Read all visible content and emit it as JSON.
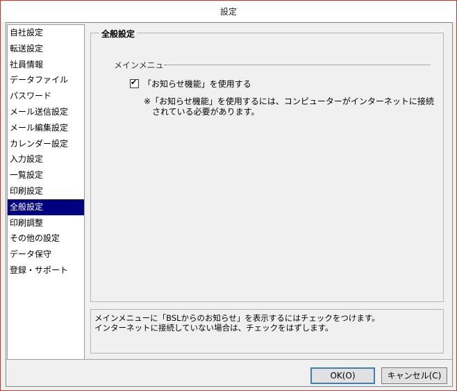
{
  "window": {
    "title": "設定"
  },
  "sidebar": {
    "items": [
      {
        "label": "自社設定"
      },
      {
        "label": "転送設定"
      },
      {
        "label": "社員情報"
      },
      {
        "label": "データファイル"
      },
      {
        "label": "パスワード"
      },
      {
        "label": "メール送信設定"
      },
      {
        "label": "メール編集設定"
      },
      {
        "label": "カレンダー設定"
      },
      {
        "label": "入力設定"
      },
      {
        "label": "一覧設定"
      },
      {
        "label": "印刷設定"
      },
      {
        "label": "全般設定",
        "selected": true
      },
      {
        "label": "印刷調整"
      },
      {
        "label": "その他の設定"
      },
      {
        "label": "データ保守"
      },
      {
        "label": "登録・サポート"
      }
    ]
  },
  "panel": {
    "title": "全般設定",
    "section": "メインメニュー",
    "checkbox_label": "「お知らせ機能」を使用する",
    "checkbox_checked": true,
    "checkmark": "✔",
    "note_line1": "※「お知らせ機能」を使用するには、コンピューターがインターネットに接続",
    "note_line2": "されている必要があります。"
  },
  "help": {
    "line1": "メインメニューに「BSLからのお知らせ」を表示するにはチェックをつけます。",
    "line2": "インターネットに接続していない場合は、チェックをはずします。"
  },
  "buttons": {
    "ok": "OK(O)",
    "cancel": "キャンセル(C)"
  }
}
